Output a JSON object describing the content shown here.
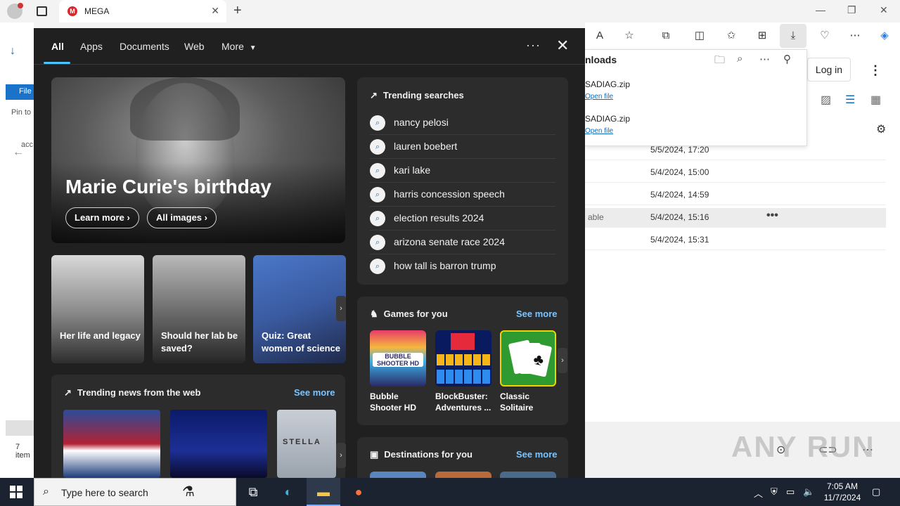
{
  "browser": {
    "tab_title": "MEGA",
    "tab_favicon": "M"
  },
  "background_page": {
    "file_button": "File",
    "pin_text_1": "Pin to",
    "pin_text_2": "acc",
    "items_count": "7 item",
    "downloads_title": "nloads",
    "downloads": [
      {
        "name": "SADIAG.zip",
        "action": "Open file"
      },
      {
        "name": "SADIAG.zip",
        "action": "Open file"
      }
    ],
    "login_label": "Log in",
    "rows": [
      {
        "name": "",
        "date": "5/5/2024, 17:20"
      },
      {
        "name": "",
        "date": "5/4/2024, 15:00"
      },
      {
        "name": "",
        "date": "5/4/2024, 14:59"
      },
      {
        "name": "able",
        "date": "5/4/2024, 15:16"
      },
      {
        "name": "",
        "date": "5/4/2024, 15:31"
      }
    ],
    "watermark": "ANY RUN"
  },
  "search_flyout": {
    "tabs": [
      "All",
      "Apps",
      "Documents",
      "Web",
      "More"
    ],
    "hero": {
      "title": "Marie Curie's birthday",
      "learn_more": "Learn more",
      "all_images": "All images"
    },
    "cards": [
      {
        "label": "Her life and legacy"
      },
      {
        "label": "Should her lab be saved?"
      },
      {
        "label": "Quiz: Great women of science"
      }
    ],
    "trending_searches": {
      "title": "Trending searches",
      "items": [
        "nancy pelosi",
        "lauren boebert",
        "kari lake",
        "harris concession speech",
        "election results 2024",
        "arizona senate race 2024",
        "how tall is barron trump"
      ]
    },
    "games": {
      "title": "Games for you",
      "see_more": "See more",
      "items": [
        {
          "label": "Bubble Shooter HD",
          "art_text": "BUBBLE SHOOTER HD"
        },
        {
          "label": "BlockBuster: Adventures ..."
        },
        {
          "label": "Classic Solitaire"
        }
      ]
    },
    "trending_news": {
      "title": "Trending news from the web",
      "see_more": "See more",
      "third_image_text": "STELLA"
    },
    "destinations": {
      "title": "Destinations for you",
      "see_more": "See more"
    }
  },
  "taskbar": {
    "search_placeholder": "Type here to search",
    "time": "7:05 AM",
    "date": "11/7/2024"
  },
  "colors": {
    "flyout_bg": "#202020",
    "panel_bg": "#2c2c2c",
    "accent_link": "#7cc4ff",
    "tab_underline": "#4cc2ff",
    "taskbar_bg": "#1c2330"
  }
}
